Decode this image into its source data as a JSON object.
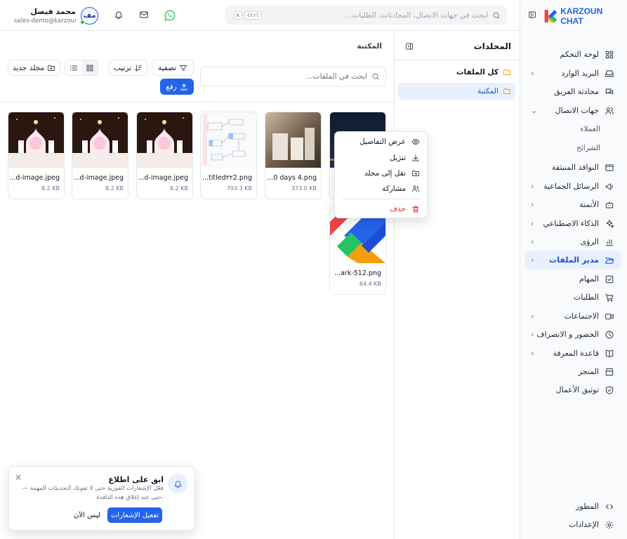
{
  "brand": {
    "name": "KARZOUN CHAT"
  },
  "sidebar": {
    "items": [
      {
        "label": "لوحة التحكم",
        "icon": "dashboard-icon"
      },
      {
        "label": "البريد الوارد",
        "icon": "inbox-icon",
        "chevron": true
      },
      {
        "label": "محادثة الفريق",
        "icon": "team-chat-icon"
      },
      {
        "label": "جهات الاتصال",
        "icon": "contacts-icon",
        "chevron": true,
        "expanded": true
      },
      {
        "label": "النوافذ المنبثقة",
        "icon": "popup-icon"
      },
      {
        "label": "الرسائل الجماعية",
        "icon": "broadcast-icon",
        "chevron": true
      },
      {
        "label": "الأتمتة",
        "icon": "bot-icon",
        "chevron": true
      },
      {
        "label": "الذكاء الاصطناعي",
        "icon": "sparkles-icon",
        "chevron": true
      },
      {
        "label": "الرؤى",
        "icon": "chart-icon",
        "chevron": true
      },
      {
        "label": "مدير الملفات",
        "icon": "folder-open-icon",
        "chevron": true,
        "active": true
      },
      {
        "label": "المهام",
        "icon": "task-icon"
      },
      {
        "label": "الطلبات",
        "icon": "cart-icon"
      },
      {
        "label": "الاجتماعات",
        "icon": "video-icon",
        "chevron": true
      },
      {
        "label": "الحضور و الانصراف",
        "icon": "clock-icon",
        "chevron": true
      },
      {
        "label": "قاعدة المعرفة",
        "icon": "book-icon",
        "chevron": true
      },
      {
        "label": "المتجر",
        "icon": "store-icon"
      },
      {
        "label": "توثيق الأعمال",
        "icon": "shield-check-icon"
      }
    ],
    "subitems": [
      "العملاء",
      "الشرائح"
    ],
    "bottom": [
      {
        "label": "المطور",
        "icon": "code-icon"
      },
      {
        "label": "الإعدادات",
        "icon": "settings-icon"
      }
    ]
  },
  "topbar": {
    "search_placeholder": "ابحث في جهات الاتصال، المحادثات، الطلبات...",
    "shortcut": [
      "Ctrl",
      "K"
    ],
    "user": {
      "initials": "مف",
      "name": "محمد فيصل",
      "email": "sales-demo@karzoun..."
    }
  },
  "folders": {
    "title": "المجلدات",
    "items": [
      {
        "label": "كل الملفات"
      },
      {
        "label": "المكتبة",
        "active": true
      }
    ]
  },
  "main": {
    "title": "المكتبة",
    "search_placeholder": "ابحث في الملفات...",
    "filter_label": "تصفية",
    "sort_label": "ترتيب",
    "new_folder_label": "مجلد جديد",
    "upload_label": "رفع",
    "files": [
      {
        "name": "...ark-512.png",
        "size": "64.4 KB"
      },
      {
        "name": "...0 days 4.png",
        "size": "373.0 KB"
      },
      {
        "name": "...titled٢٢2.png",
        "size": "793.3 KB"
      },
      {
        "name": "...d-image.jpeg",
        "size": "8.2 KB"
      },
      {
        "name": "...d-image.jpeg",
        "size": "8.2 KB"
      },
      {
        "name": "...d-image.jpeg",
        "size": "8.2 KB"
      }
    ]
  },
  "context_menu": {
    "items": [
      {
        "label": "عرض التفاصيل",
        "icon": "eye-icon"
      },
      {
        "label": "تنزيل",
        "icon": "download-icon"
      },
      {
        "label": "نقل إلى مجلد",
        "icon": "folder-move-icon"
      },
      {
        "label": "مشاركة",
        "icon": "share-users-icon"
      },
      {
        "label": "حذف",
        "icon": "trash-icon",
        "danger": true
      }
    ]
  },
  "toast": {
    "title": "ابق على اطلاع",
    "message": "فعّل الإشعارات الفورية حتى لا تفوتك التحديثات المهمة — حتى عند إغلاق هذه النافذة.",
    "enable_label": "تفعيل الإشعارات",
    "later_label": "ليس الآن",
    "close_label": "×"
  },
  "colors": {
    "accent": "#2563eb",
    "active_bg": "#e8f0fe",
    "danger": "#dc2626",
    "whatsapp": "#22c55e",
    "folder": "#f59e0b"
  }
}
